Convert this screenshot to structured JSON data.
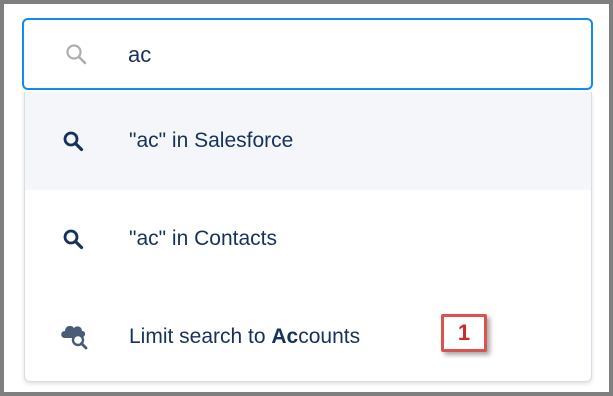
{
  "search": {
    "icon": "search-icon",
    "value": "ac"
  },
  "options": [
    {
      "icon": "search-icon",
      "prefix": "\"ac\" in Salesforce",
      "highlighted": true
    },
    {
      "icon": "search-icon",
      "prefix": "\"ac\" in Contacts",
      "highlighted": false
    },
    {
      "icon": "cloud-search-icon",
      "prefix": "Limit search to ",
      "bold": "Ac",
      "suffix": "counts",
      "highlighted": false
    }
  ],
  "callout": {
    "label": "1"
  },
  "colors": {
    "frame_border": "#7f7f7f",
    "focus_border": "#1589ee",
    "text": "#16325c",
    "highlight_bg": "#f4f6f9",
    "icon": "#5a6a85",
    "callout": "#d9534f"
  }
}
